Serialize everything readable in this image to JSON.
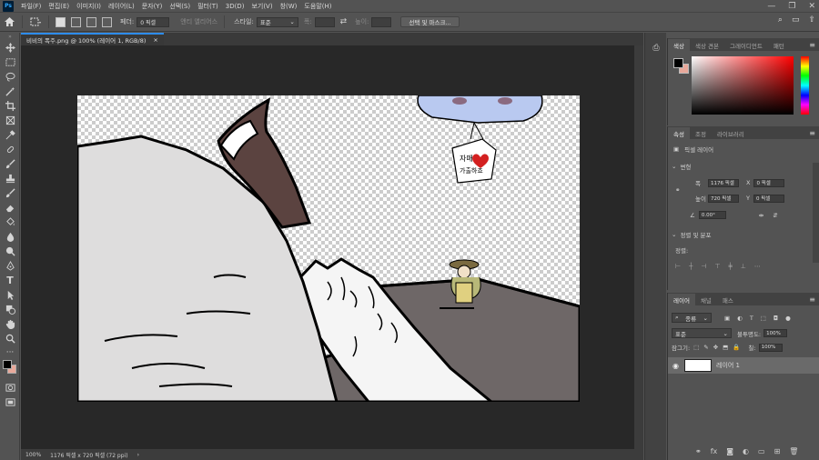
{
  "app": {
    "logo": "Ps"
  },
  "menu": [
    "파일(F)",
    "편집(E)",
    "이미지(I)",
    "레이어(L)",
    "문자(Y)",
    "선택(S)",
    "필터(T)",
    "3D(D)",
    "보기(V)",
    "창(W)",
    "도움말(H)"
  ],
  "options": {
    "feather_label": "페더:",
    "feather_value": "0 픽셀",
    "antialias_label": "앤티 앨리어스",
    "style_label": "스타일:",
    "style_value": "표준",
    "width_label": "폭:",
    "height_label": "높이:",
    "select_mask_button": "선택 및 마스크..."
  },
  "document": {
    "tab_title": "비비의 폭주.png @ 100% (레이어 1, RGB/8)",
    "close_glyph": "×",
    "sign_text_1": "자매",
    "sign_text_2": "가출하죠"
  },
  "status": {
    "zoom": "100%",
    "doc_info": "1176 픽셀 x 720 픽셀 (72 ppi)"
  },
  "color_panel": {
    "tabs": [
      "색상",
      "색상 견본",
      "그레이디언트",
      "패턴"
    ]
  },
  "properties_panel": {
    "tabs": [
      "속성",
      "조정",
      "라이브러리"
    ],
    "layer_type": "픽셀 레이어",
    "transform_title": "변형",
    "w_label": "폭",
    "w_value": "1176 픽셀",
    "x_label": "X",
    "x_value": "0 픽셀",
    "h_label": "높이",
    "h_value": "720 픽셀",
    "y_label": "Y",
    "y_value": "0 픽셀",
    "angle_value": "0.00°",
    "align_title": "정렬 및 분포",
    "align_label": "정렬:"
  },
  "layers_panel": {
    "tabs": [
      "레이어",
      "채널",
      "패스"
    ],
    "filter_label": "종류",
    "blend_mode": "표준",
    "opacity_label": "불투명도:",
    "opacity_value": "100%",
    "lock_label": "잠그기:",
    "fill_label": "칠:",
    "fill_value": "100%",
    "layer_name": "레이어 1"
  },
  "colors": {
    "foreground": "#000000",
    "background": "#e8a89a",
    "accent": "#2d8ceb"
  }
}
